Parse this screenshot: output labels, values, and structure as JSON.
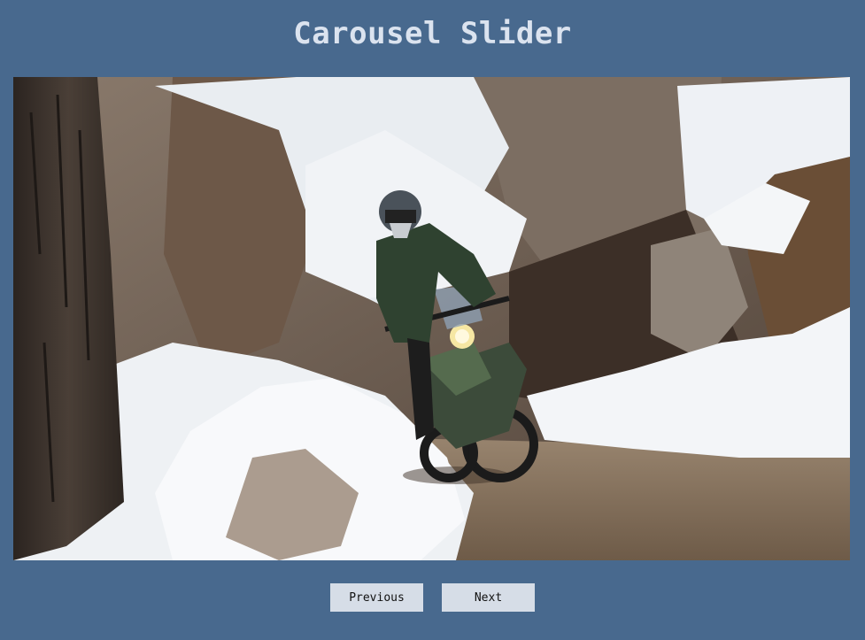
{
  "page": {
    "title": "Carousel Slider"
  },
  "slide": {
    "image_name": "motorcycle-snow-trail-photo"
  },
  "controls": {
    "previous_label": "Previous",
    "next_label": "Next"
  },
  "colors": {
    "background": "#48698e",
    "title": "#dbe3ef",
    "button_bg": "#d6dde7"
  }
}
